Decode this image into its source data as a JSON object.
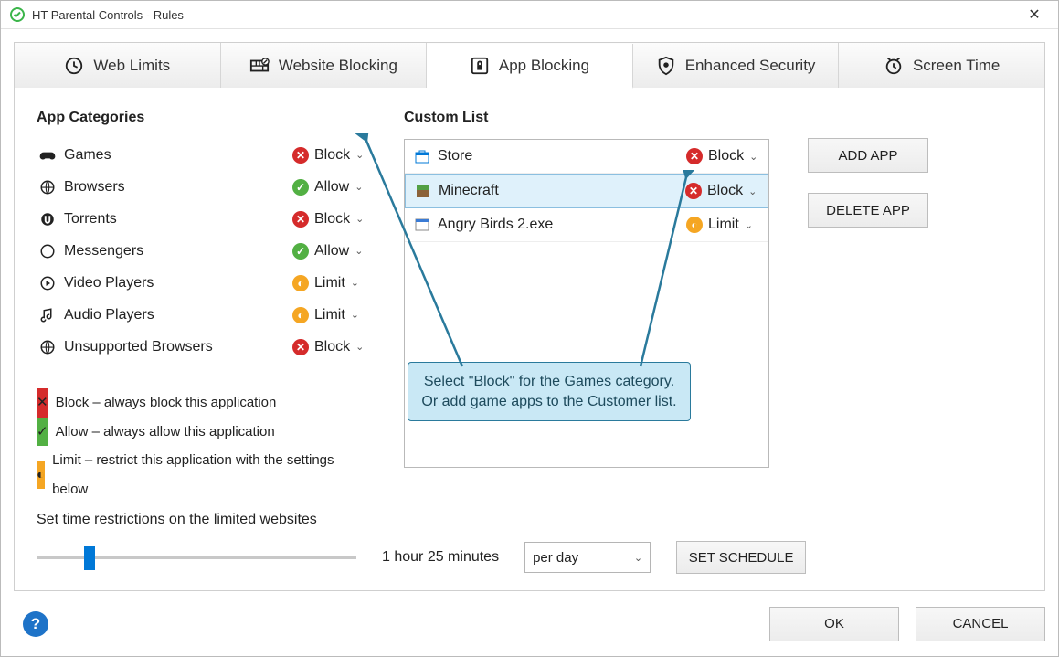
{
  "window": {
    "title": "HT Parental Controls - Rules"
  },
  "tabs": [
    {
      "label": "Web Limits"
    },
    {
      "label": "Website Blocking"
    },
    {
      "label": "App Blocking"
    },
    {
      "label": "Enhanced Security"
    },
    {
      "label": "Screen Time"
    }
  ],
  "active_tab_index": 2,
  "sections": {
    "categories_title": "App Categories",
    "custom_title": "Custom List"
  },
  "categories": [
    {
      "name": "Games",
      "action": "Block"
    },
    {
      "name": "Browsers",
      "action": "Allow"
    },
    {
      "name": "Torrents",
      "action": "Block"
    },
    {
      "name": "Messengers",
      "action": "Allow"
    },
    {
      "name": "Video Players",
      "action": "Limit"
    },
    {
      "name": "Audio Players",
      "action": "Limit"
    },
    {
      "name": "Unsupported Browsers",
      "action": "Block"
    }
  ],
  "legend": {
    "block": "Block – always block this application",
    "allow": "Allow – always allow this application",
    "limit": "Limit – restrict this application with the settings below"
  },
  "custom_list": [
    {
      "name": "Store",
      "action": "Block",
      "selected": false
    },
    {
      "name": "Minecraft",
      "action": "Block",
      "selected": true
    },
    {
      "name": "Angry Birds 2.exe",
      "action": "Limit",
      "selected": false
    }
  ],
  "buttons": {
    "add_app": "ADD APP",
    "delete_app": "DELETE APP",
    "set_schedule": "SET SCHEDULE",
    "ok": "OK",
    "cancel": "CANCEL"
  },
  "time": {
    "label": "Set time restrictions on the limited websites",
    "value_text": "1 hour 25 minutes",
    "unit": "per day"
  },
  "callout": "Select \"Block\" for the Games category. Or add game apps to the Customer list."
}
